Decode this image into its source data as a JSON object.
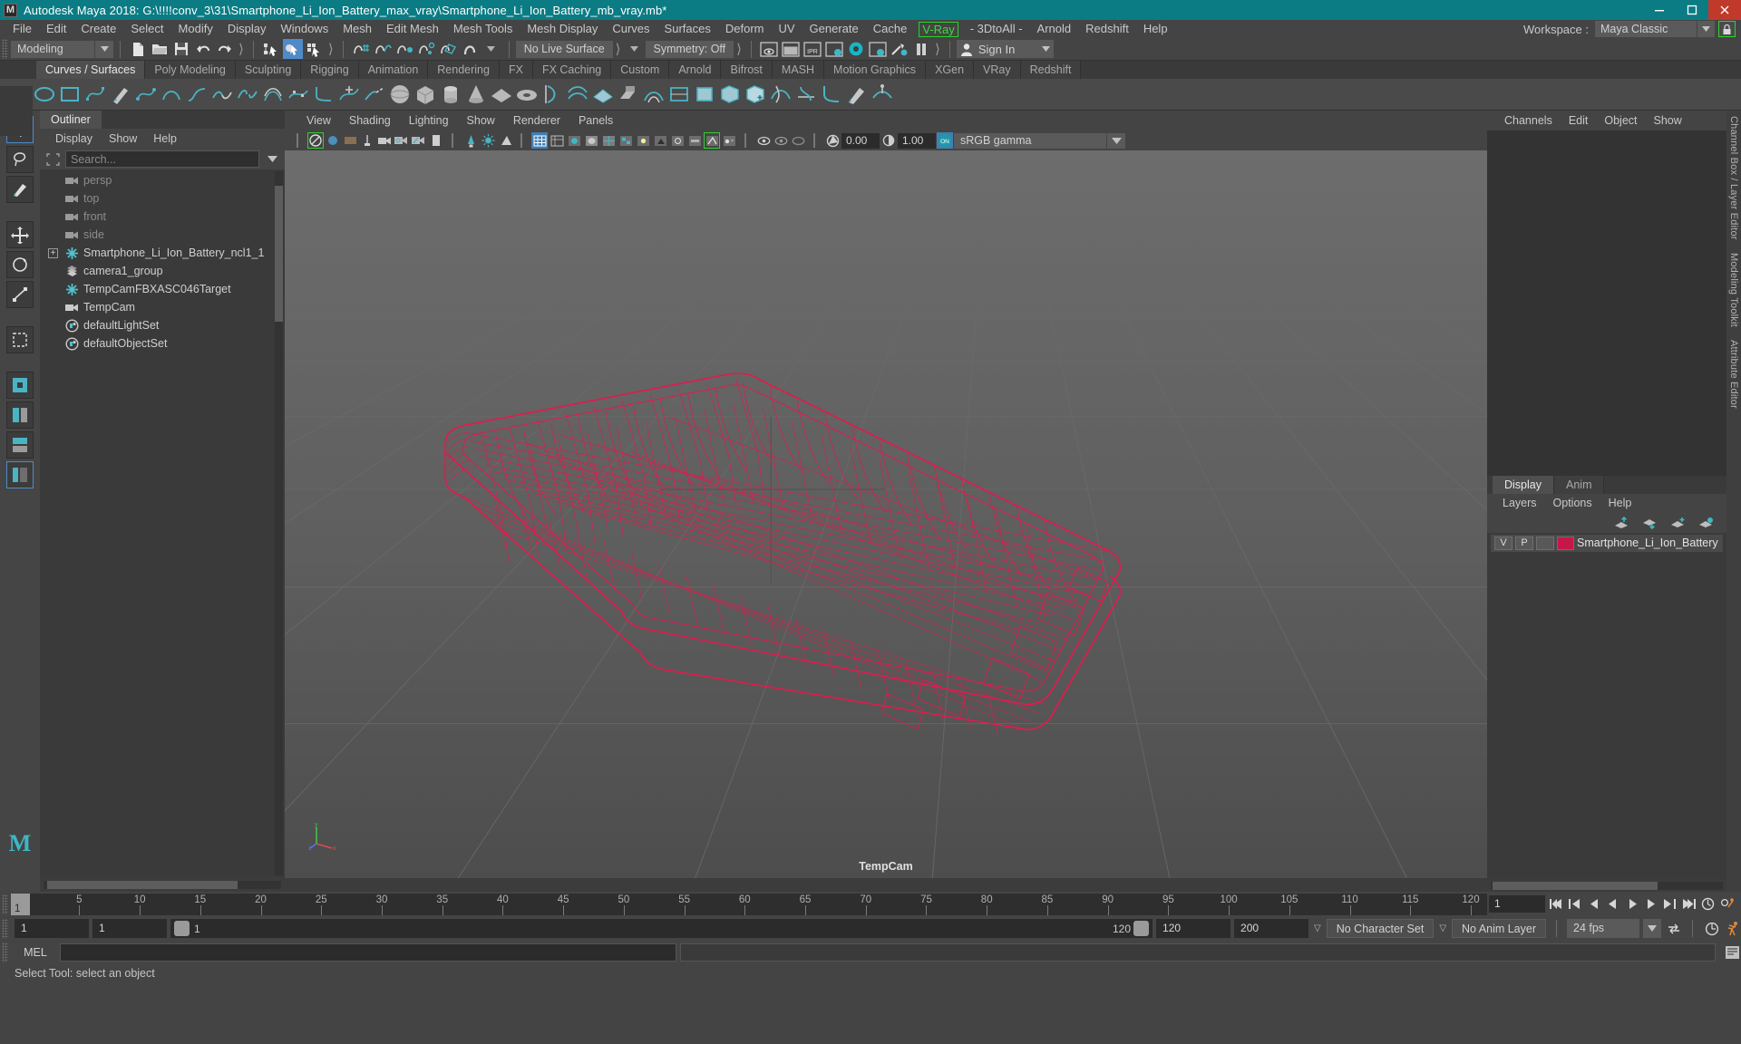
{
  "titlebar": {
    "app_title": "Autodesk Maya 2018: G:\\!!!!conv_3\\31\\Smartphone_Li_Ion_Battery_max_vray\\Smartphone_Li_Ion_Battery_mb_vray.mb*",
    "logo_letter": "M",
    "minimize": "minimize-icon",
    "maximize": "maximize-icon",
    "close": "close-icon",
    "bar_color": "#0b7c84"
  },
  "menubar": {
    "items": [
      "File",
      "Edit",
      "Create",
      "Select",
      "Modify",
      "Display",
      "Windows",
      "Mesh",
      "Edit Mesh",
      "Mesh Tools",
      "Mesh Display",
      "Curves",
      "Surfaces",
      "Deform",
      "UV",
      "Generate",
      "Cache"
    ],
    "vray": "V-Ray",
    "after_vray": [
      "- 3DtoAll -",
      "Arnold",
      "Redshift",
      "Help"
    ],
    "vray_color": "#3ddb3d"
  },
  "workspace": {
    "label": "Workspace :",
    "value": "Maya Classic",
    "lock_icon": "lock-icon",
    "lock_color": "#32d132"
  },
  "statusline": {
    "menuset": "Modeling",
    "live_surface": "No Live Surface",
    "symmetry": "Symmetry: Off",
    "sign_in": "Sign In"
  },
  "shelf": {
    "tabs": [
      {
        "label": "Curves / Surfaces",
        "active": true
      },
      {
        "label": "Poly Modeling",
        "active": false
      },
      {
        "label": "Sculpting",
        "active": false
      },
      {
        "label": "Rigging",
        "active": false
      },
      {
        "label": "Animation",
        "active": false
      },
      {
        "label": "Rendering",
        "active": false
      },
      {
        "label": "FX",
        "active": false
      },
      {
        "label": "FX Caching",
        "active": false
      },
      {
        "label": "Custom",
        "active": false
      },
      {
        "label": "Arnold",
        "active": false
      },
      {
        "label": "Bifrost",
        "active": false
      },
      {
        "label": "MASH",
        "active": false
      },
      {
        "label": "Motion Graphics",
        "active": false
      },
      {
        "label": "XGen",
        "active": false
      },
      {
        "label": "VRay",
        "active": false
      },
      {
        "label": "Redshift",
        "active": false
      }
    ]
  },
  "outliner": {
    "tab": "Outliner",
    "menu": [
      "Display",
      "Show",
      "Help"
    ],
    "search_placeholder": "Search...",
    "items": [
      {
        "label": "persp",
        "icon": "camera-icon",
        "dim": true,
        "expandable": false
      },
      {
        "label": "top",
        "icon": "camera-icon",
        "dim": true,
        "expandable": false
      },
      {
        "label": "front",
        "icon": "camera-icon",
        "dim": true,
        "expandable": false
      },
      {
        "label": "side",
        "icon": "camera-icon",
        "dim": true,
        "expandable": false
      },
      {
        "label": "Smartphone_Li_Ion_Battery_ncl1_1",
        "icon": "transform-icon",
        "dim": false,
        "expandable": true
      },
      {
        "label": "camera1_group",
        "icon": "group-icon",
        "dim": false,
        "expandable": false
      },
      {
        "label": "TempCamFBXASC046Target",
        "icon": "transform-icon",
        "dim": false,
        "expandable": false
      },
      {
        "label": "TempCam",
        "icon": "camera-icon",
        "dim": false,
        "expandable": false
      },
      {
        "label": "defaultLightSet",
        "icon": "set-icon",
        "dim": false,
        "expandable": false
      },
      {
        "label": "defaultObjectSet",
        "icon": "set-icon",
        "dim": false,
        "expandable": false
      }
    ]
  },
  "viewport": {
    "menu": [
      "View",
      "Shading",
      "Lighting",
      "Show",
      "Renderer",
      "Panels"
    ],
    "exposure": "0.00",
    "gamma": "1.00",
    "color_mgmt": "sRGB gamma",
    "camera_label": "TempCam",
    "model_name": "Smartphone Li-Ion Battery wireframe",
    "wireframe_color": "#e11b4d",
    "bg_top": "#6f6f6f",
    "bg_bottom": "#4e4e4e"
  },
  "channelbox": {
    "menu": [
      "Channels",
      "Edit",
      "Object",
      "Show"
    ],
    "side_tabs": [
      "Channel Box / Layer Editor",
      "Modeling Toolkit",
      "Attribute Editor"
    ]
  },
  "layereditor": {
    "tabs": [
      {
        "label": "Display",
        "active": true
      },
      {
        "label": "Anim",
        "active": false
      }
    ],
    "menu": [
      "Layers",
      "Options",
      "Help"
    ],
    "layers": [
      {
        "visible": "V",
        "playback": "P",
        "color": "#c7164a",
        "name": "Smartphone_Li_Ion_Battery"
      }
    ]
  },
  "timeslider": {
    "current_frame": "1",
    "ticks": [
      5,
      10,
      15,
      20,
      25,
      30,
      35,
      40,
      45,
      50,
      55,
      60,
      65,
      70,
      75,
      80,
      85,
      90,
      95,
      100,
      105,
      110,
      115,
      120
    ],
    "range_start": 1,
    "range_end": 120,
    "right_field": "1"
  },
  "rangeslider": {
    "anim_start": "1",
    "range_start": "1",
    "slider_start_label": "1",
    "slider_end_label": "120",
    "range_end": "120",
    "anim_end": "200",
    "character_set": "No Character Set",
    "anim_layer": "No Anim Layer",
    "fps": "24 fps"
  },
  "commandline": {
    "language": "MEL",
    "input_value": "",
    "output_value": ""
  },
  "helpline": {
    "text": "Select Tool: select an object"
  }
}
